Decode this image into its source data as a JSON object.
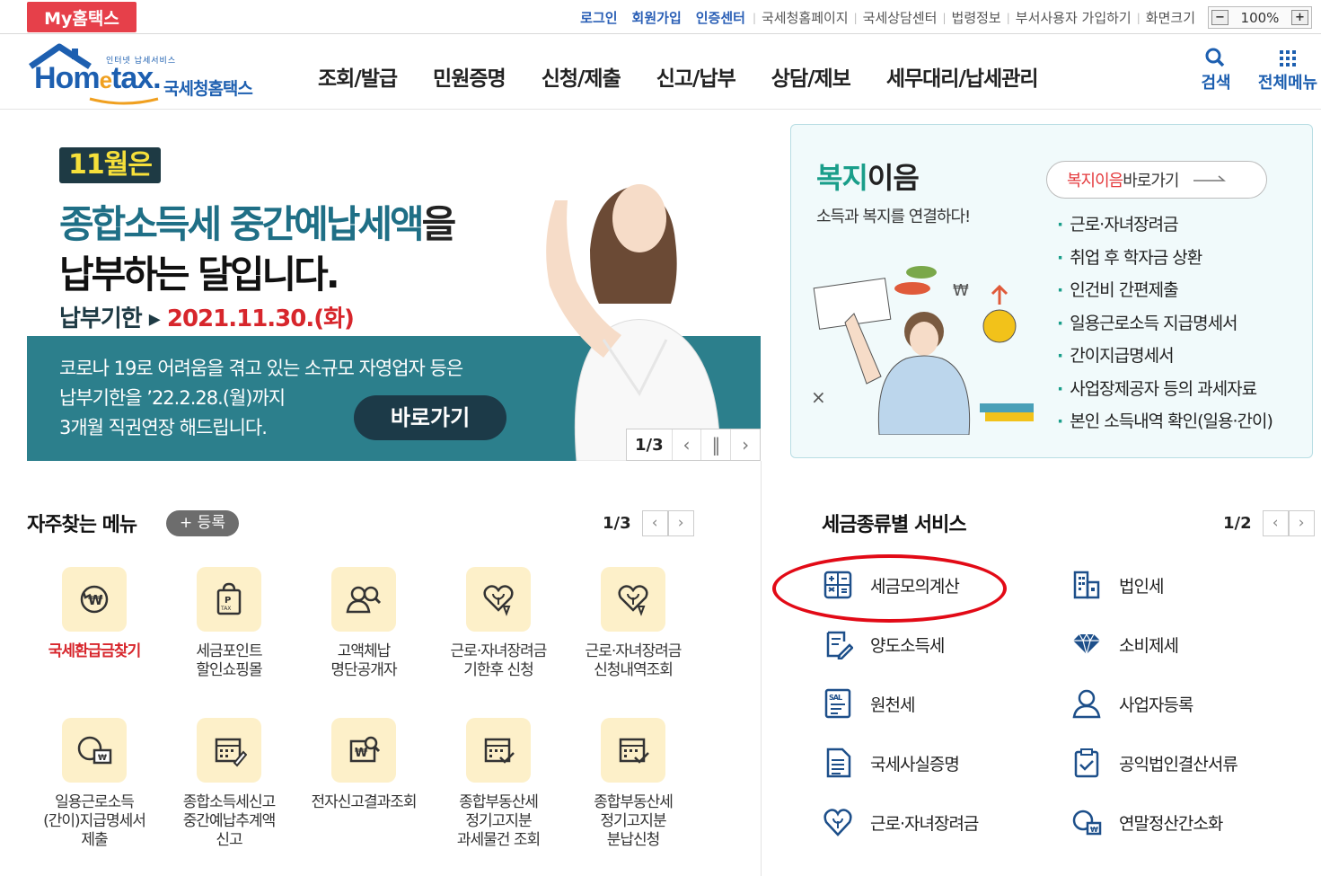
{
  "topbar": {
    "mytax": "My홈택스",
    "links": [
      "로그인",
      "회원가입",
      "인증센터",
      "국세청홈페이지",
      "국세상담센터",
      "법령정보",
      "부서사용자 가입하기",
      "화면크기"
    ],
    "zoom": "100%"
  },
  "header": {
    "logo_small": "인터넷 납세서비스",
    "logo_brand_a": "Hom",
    "logo_brand_e": "e",
    "logo_brand_b": "tax.",
    "logo_kr": "국세청홈택스",
    "nav": [
      "조회/발급",
      "민원증명",
      "신청/제출",
      "신고/납부",
      "상담/제보",
      "세무대리/납세관리"
    ],
    "search": "검색",
    "allmenu": "전체메뉴"
  },
  "banner": {
    "tag": "11월은",
    "line1_a": "종합소득세 중간예납세액",
    "line1_b": "을",
    "line2": "납부하는 달입니다.",
    "due_label": "납부기한 ▸",
    "due_date": "2021.11.30.(화)",
    "note": "코로나 19로 어려움을 겪고 있는 소규모 자영업자 등은\n납부기한을 ’22.2.28.(월)까지\n3개월 직권연장 해드립니다.",
    "go": "바로가기",
    "pager": "1/3"
  },
  "welfare": {
    "title_a": "복지",
    "title_b": "이음",
    "sub": "소득과 복지를 연결하다!",
    "btn_a": "복지이음",
    "btn_b": " 바로가기",
    "items": [
      "근로·자녀장려금",
      "취업 후 학자금 상환",
      "인건비 간편제출",
      "일용근로소득 지급명세서",
      "간이지급명세서",
      "사업장제공자 등의 과세자료",
      "본인 소득내역 확인(일용·간이)"
    ]
  },
  "favorites": {
    "title": "자주찾는 메뉴",
    "register": "+ 등록",
    "pager": "1/3",
    "items": [
      {
        "label": "국세환급금찾기",
        "icon": "refund-icon"
      },
      {
        "label": "세금포인트\n할인쇼핑몰",
        "icon": "tax-bag-icon"
      },
      {
        "label": "고액체납\n명단공개자",
        "icon": "people-search-icon"
      },
      {
        "label": "근로·자녀장려금\n기한후 신청",
        "icon": "heart-plant-icon"
      },
      {
        "label": "근로·자녀장려금\n신청내역조회",
        "icon": "heart-plant-icon"
      },
      {
        "label": "일용근로소득\n(간이)지급명세서\n제출",
        "icon": "payment-icon"
      },
      {
        "label": "종합소득세신고\n중간예납추계액\n신고",
        "icon": "calendar-pen-icon"
      },
      {
        "label": "전자신고결과조회",
        "icon": "won-search-icon"
      },
      {
        "label": "종합부동산세\n정기고지분\n과세물건 조회",
        "icon": "calendar-check-icon"
      },
      {
        "label": "종합부동산세\n정기고지분\n분납신청",
        "icon": "calendar-check-icon"
      }
    ]
  },
  "taxservices": {
    "title": "세금종류별 서비스",
    "pager": "1/2",
    "items": [
      {
        "label": "세금모의계산",
        "icon": "calculator-icon"
      },
      {
        "label": "법인세",
        "icon": "building-icon"
      },
      {
        "label": "양도소득세",
        "icon": "document-pen-icon"
      },
      {
        "label": "소비제세",
        "icon": "diamond-icon"
      },
      {
        "label": "원천세",
        "icon": "salary-doc-icon"
      },
      {
        "label": "사업자등록",
        "icon": "person-icon"
      },
      {
        "label": "국세사실증명",
        "icon": "certificate-icon"
      },
      {
        "label": "공익법인결산서류",
        "icon": "clipboard-check-icon"
      },
      {
        "label": "근로·자녀장려금",
        "icon": "heart-plant-icon"
      },
      {
        "label": "연말정산간소화",
        "icon": "money-icon"
      }
    ]
  },
  "colors": {
    "brand_blue": "#1d5fb0",
    "mytax_red": "#e6404a",
    "banner_teal": "#2c7f8c",
    "highlight_red": "#e20a16"
  }
}
